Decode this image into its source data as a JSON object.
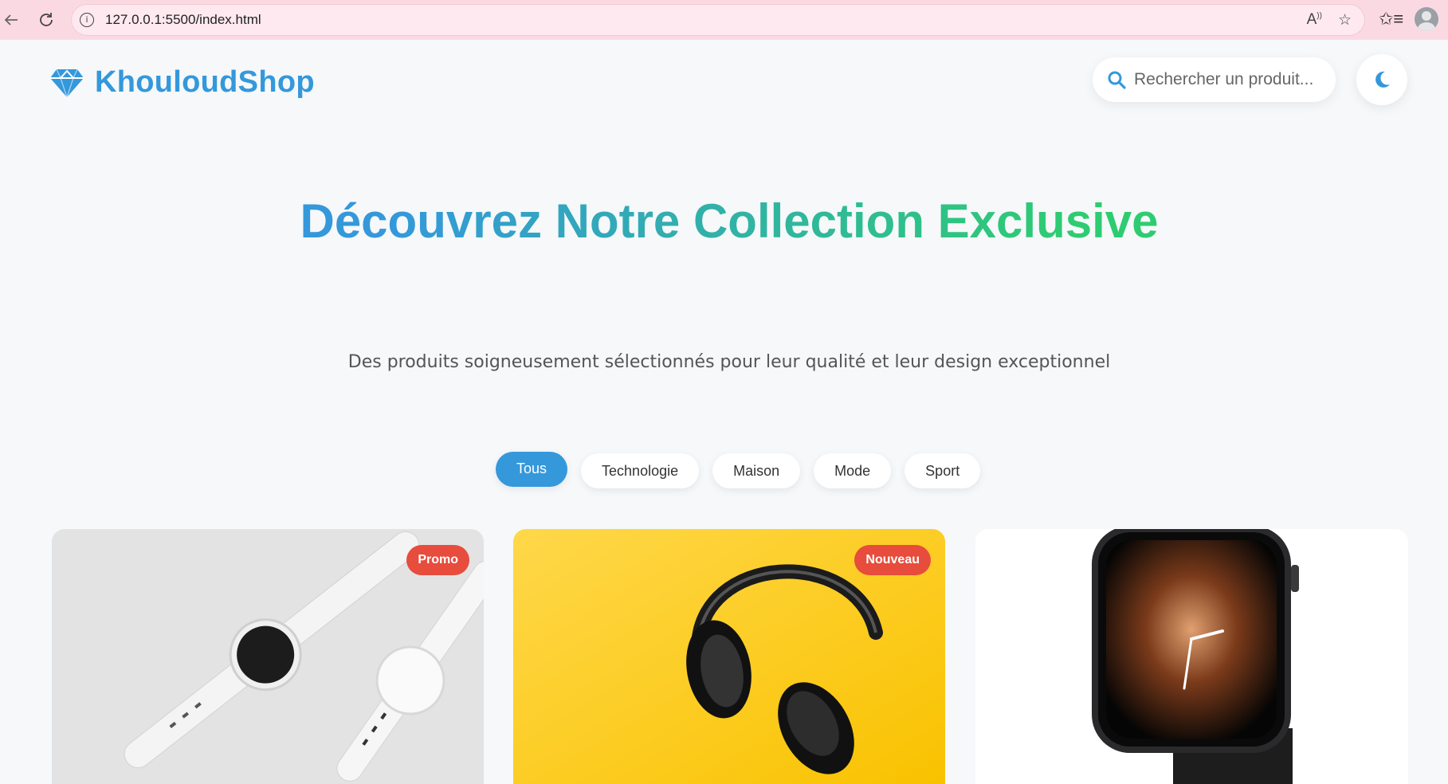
{
  "browser": {
    "url": "127.0.0.1:5500/index.html"
  },
  "header": {
    "brand": "KhouloudShop",
    "search_placeholder": "Rechercher un produit...",
    "theme_icon": "moon-icon"
  },
  "hero": {
    "title": "Découvrez Notre Collection Exclusive",
    "subtitle": "Des produits soigneusement sélectionnés pour leur qualité et leur design exceptionnel"
  },
  "filters": [
    {
      "label": "Tous",
      "active": true
    },
    {
      "label": "Technologie",
      "active": false
    },
    {
      "label": "Maison",
      "active": false
    },
    {
      "label": "Mode",
      "active": false
    },
    {
      "label": "Sport",
      "active": false
    }
  ],
  "products": [
    {
      "badge": "Promo",
      "image": "white-smartwatches"
    },
    {
      "badge": "Nouveau",
      "image": "black-headphones-on-yellow"
    },
    {
      "badge": "",
      "image": "apple-watch"
    }
  ],
  "colors": {
    "primary": "#3498db",
    "accent": "#2ecc71",
    "badge": "#e74c3c",
    "chrome": "#fbd9e3"
  }
}
